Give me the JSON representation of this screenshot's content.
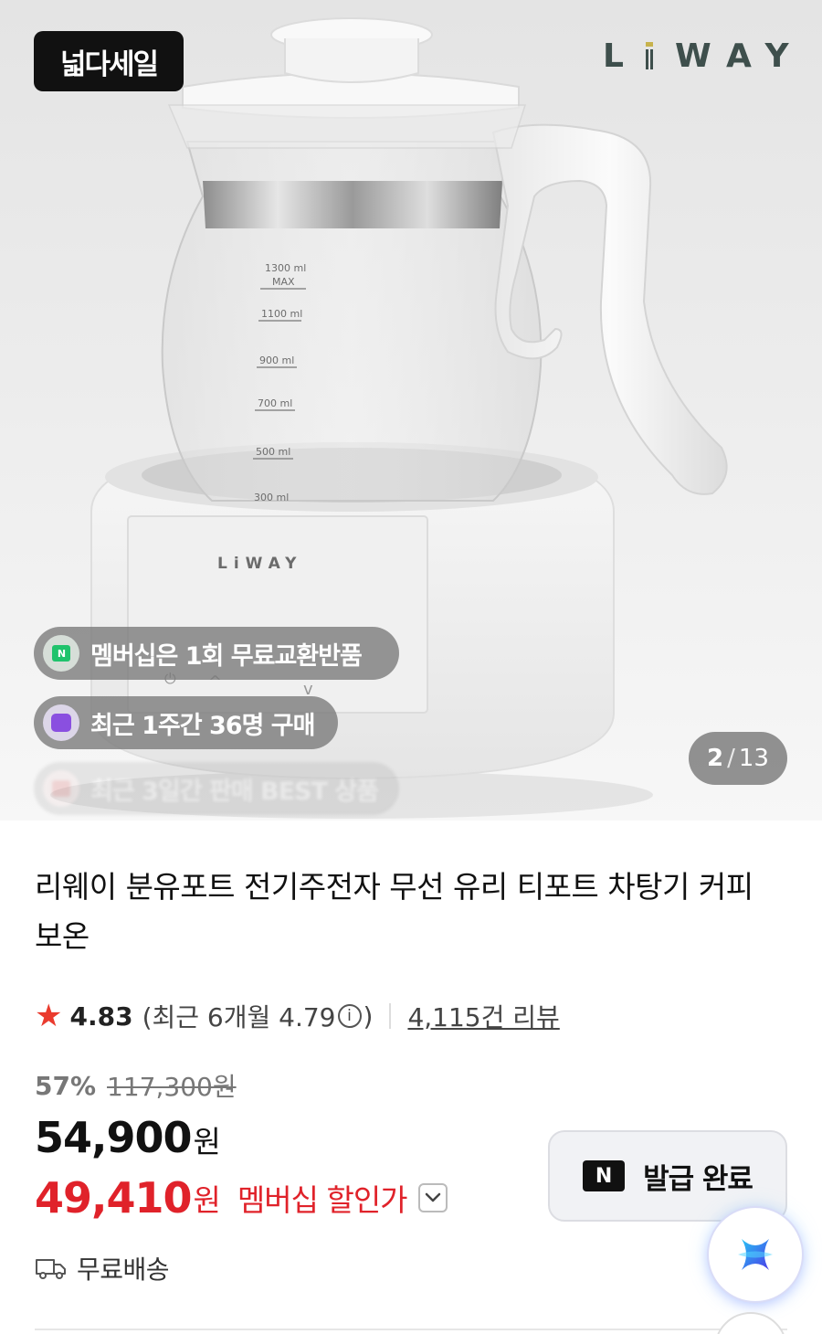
{
  "hero": {
    "sale_badge": "넓다세일",
    "brand_logo": "LiWAY",
    "scale_marks": [
      "1300 ml",
      "MAX",
      "1100 ml",
      "900 ml",
      "700 ml",
      "500 ml",
      "300 ml"
    ],
    "pills": [
      {
        "label": "멤버십은 1회 무료교환반품",
        "icon": "naver-membership-icon"
      },
      {
        "label": "최근 1주간 36명 구매",
        "icon": "shopping-bag-icon"
      },
      {
        "label": "최근 3일간 판매 BEST 상품",
        "icon": "trophy-icon"
      }
    ],
    "counter": {
      "current": "2",
      "separator": "/",
      "total": "13"
    }
  },
  "product": {
    "title": "리웨이 분유포트 전기주전자 무선 유리 티포트 차탕기 커피 보온",
    "rating": {
      "score": "4.83",
      "recent_prefix": "(최근 6개월 4.79",
      "recent_suffix": ")",
      "review_count": "4,115건 리뷰"
    },
    "discount_percent": "57%",
    "original_price": "117,300원",
    "price": "54,900",
    "price_unit": "원",
    "member_price": "49,410",
    "member_price_unit": "원",
    "member_price_label": "멤버십 할인가",
    "coupon_button": {
      "icon_text": "N",
      "label": "발급 완료"
    },
    "shipping": "무료배송"
  },
  "colors": {
    "accent_red": "#e0222a",
    "star": "#ea3b2e",
    "brand_green": "#3e4f4c",
    "brand_gold": "#c7b24c"
  }
}
